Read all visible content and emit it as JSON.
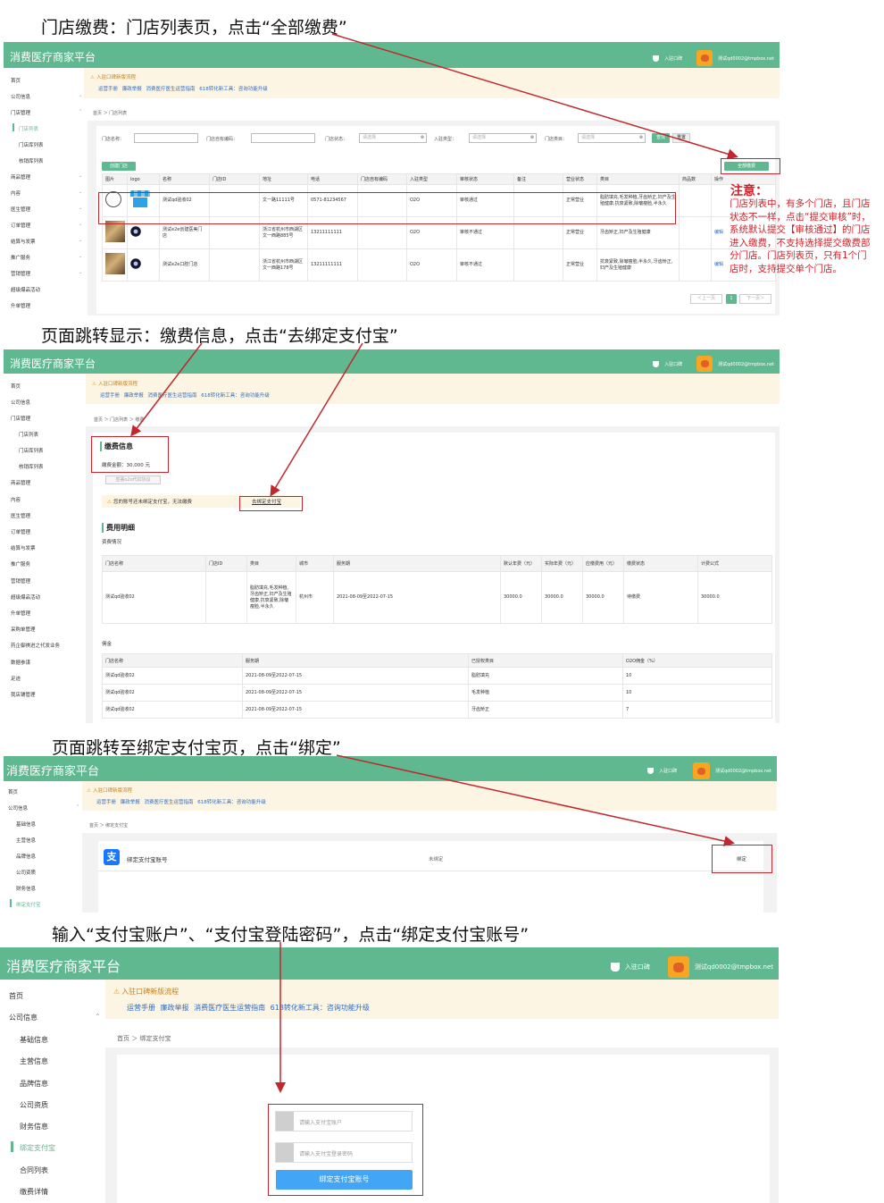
{
  "captions": {
    "step1": "门店缴费：门店列表页，点击“全部缴费”",
    "step2": "页面跳转显示：缴费信息，点击“去绑定支付宝”",
    "step3": "页面跳转至绑定支付宝页，点击“绑定”",
    "step4": "输入“支付宝账户”、“支付宝登陆密码”，点击“绑定支付宝账号”"
  },
  "app": {
    "brand": "消费医疗商家平台",
    "enter_code": "入驻口碑",
    "user_email": "测试qd0002@tmpbox.net"
  },
  "notice": {
    "title": "入驻口碑新版流程",
    "links": "运营手册 廉政举报 消费医疗医生运营指南 618转化新工具：咨询功能升级"
  },
  "panel1": {
    "sidebar": [
      {
        "label": "首页",
        "chev": ""
      },
      {
        "label": "公司信息",
        "chev": "⌄"
      },
      {
        "label": "门店管理",
        "chev": "⌃"
      },
      {
        "label": "门店列表",
        "chev": ""
      },
      {
        "label": "门店库列表",
        "chev": ""
      },
      {
        "label": "核销库列表",
        "chev": ""
      },
      {
        "label": "商品管理",
        "chev": "⌄"
      },
      {
        "label": "内容",
        "chev": "⌄"
      },
      {
        "label": "医生管理",
        "chev": "⌄"
      },
      {
        "label": "订单管理",
        "chev": "⌄"
      },
      {
        "label": "结算与发票",
        "chev": "⌄"
      },
      {
        "label": "推广服务",
        "chev": "⌄"
      },
      {
        "label": "营销管理",
        "chev": "⌄"
      },
      {
        "label": "超级爆品活动",
        "chev": ""
      },
      {
        "label": "升单管理",
        "chev": ""
      }
    ],
    "breadcrumb": "首页 ＞ 门店列表",
    "filters": {
      "store_name": "门店名称：",
      "store_code": "门店自有编码：",
      "store_status": "门店状态：",
      "entry_type": "入驻类型：",
      "store_category": "门店类目：",
      "placeholder": "请选择",
      "search": "查找",
      "reset": "重置"
    },
    "create_btn": "创建门店",
    "pay_all_btn": "全部缴费",
    "columns": [
      "图片",
      "logo",
      "名称",
      "门店ID",
      "地址",
      "电话",
      "门店自有编码",
      "入驻类型",
      "审核状态",
      "备注",
      "营业状态",
      "类目",
      "商品数",
      "操作"
    ],
    "rows": [
      {
        "name": "测试qd验收02",
        "id": "",
        "address": "文一路11111号",
        "phone": "0571-81234567",
        "code": "",
        "type": "O2O",
        "audit": "审核通过",
        "remark": "",
        "biz": "正常营业",
        "category": "脂肪填充,毛发种植,牙齿矫正,妇产及生殖健康,抗衰紧致,除皱瘦脸,半永久",
        "goods": "",
        "op": ""
      },
      {
        "name": "测试e2e创建医美门店",
        "id": "",
        "address": "浙江省杭州市西湖区文一西路885号",
        "phone": "13211111111",
        "code": "",
        "type": "O2O",
        "audit": "审核不通过",
        "remark": "",
        "biz": "正常营业",
        "category": "牙齿矫正,妇产及生殖健康",
        "goods": "",
        "op": "编辑"
      },
      {
        "name": "测试e2e口腔门店",
        "id": "",
        "address": "浙江省杭州市西湖区文一西路178号",
        "phone": "13211111111",
        "code": "",
        "type": "O2O",
        "audit": "审核不通过",
        "remark": "",
        "biz": "正常营业",
        "category": "抗衰紧致,除皱瘦脸,半永久,牙齿矫正,妇产及生殖健康",
        "goods": "",
        "op": "编辑"
      }
    ],
    "pagination": {
      "prev": "＜上一页",
      "page": "1",
      "next": "下一页＞"
    },
    "note_title": "注意：",
    "note_body": "门店列表中，有多个门店，且门店状态不一样，点击“提交审核”时，系统默认提交【审核通过】的门店进入缴费，不支持选择提交缴费部分门店。门店列表页，只有1个门店时，支持提交单个门店。"
  },
  "panel2": {
    "sidebar": [
      "首页",
      "公司信息",
      "门店管理",
      "门店列表",
      "门店库列表",
      "核销库列表",
      "商品管理",
      "内容",
      "医生管理",
      "订单管理",
      "结算与发票",
      "推广服务",
      "营销管理",
      "超级爆品活动",
      "升单管理",
      "采购单管理",
      "药企御祺进之代发业务",
      "数据参谋",
      "足迹",
      "我店铺管理"
    ],
    "breadcrumb": "首页 ＞ 门店列表 ＞ 缴费",
    "pay_title": "缴费信息",
    "pay_amount": "缴费金额：30,000 元",
    "agreement_btn": "签署o2o代扣协议",
    "warn_text": "您的账号还未绑定支付宝，无法缴费",
    "bind_link": "去绑定支付宝",
    "detail_title": "费用明细",
    "fee_label": "资费情况",
    "fee_columns": [
      "门店名称",
      "门店ID",
      "类目",
      "城市",
      "服务期",
      "默认年费（元）",
      "实际年费（元）",
      "应缴费用（元）",
      "缴费状态",
      "计费公式"
    ],
    "fee_row": {
      "name": "测试qd验收02",
      "id": "",
      "category": "脂肪填充,毛发种植,牙齿矫正,妇产及生殖健康,抗衰紧致,除皱瘦脸,半永久",
      "city": "杭州市",
      "period": "2021-08-09至2022-07-15",
      "default_fee": "30000.0",
      "actual_fee": "30000.0",
      "due_fee": "30000.0",
      "status": "待缴费",
      "formula": "30000.0"
    },
    "comm_label": "佣金",
    "comm_columns": [
      "门店名称",
      "服务期",
      "已授权类目",
      "O2O佣金（%）"
    ],
    "comm_rows": [
      {
        "name": "测试qd验收02",
        "period": "2021-08-09至2022-07-15",
        "category": "脂肪填充",
        "rate": "10"
      },
      {
        "name": "测试qd验收02",
        "period": "2021-08-09至2022-07-15",
        "category": "毛发种植",
        "rate": "10"
      },
      {
        "name": "测试qd验收02",
        "period": "2021-08-09至2022-07-15",
        "category": "牙齿矫正",
        "rate": "7"
      }
    ]
  },
  "panel3": {
    "sidebar": [
      "首页",
      "公司信息",
      "基础信息",
      "主营信息",
      "品牌信息",
      "公司资质",
      "财务信息",
      "绑定支付宝"
    ],
    "breadcrumb": "首页 ＞ 绑定支付宝",
    "alipay_icon": "支",
    "row_title": "绑定支付宝账号",
    "status": "未绑定",
    "bind_btn": "绑定"
  },
  "panel4": {
    "sidebar": [
      "首页",
      "公司信息",
      "基础信息",
      "主营信息",
      "品牌信息",
      "公司资质",
      "财务信息",
      "绑定支付宝",
      "合同列表",
      "缴费详情"
    ],
    "breadcrumb": "首页 ＞ 绑定支付宝",
    "account_placeholder": "请输入支付宝账户",
    "password_placeholder": "请输入支付宝登录密码",
    "submit": "绑定支付宝账号"
  },
  "colors": {
    "brand_green": "#5fb890",
    "red_annotation": "#c0282e",
    "alipay_blue": "#1677ff"
  }
}
